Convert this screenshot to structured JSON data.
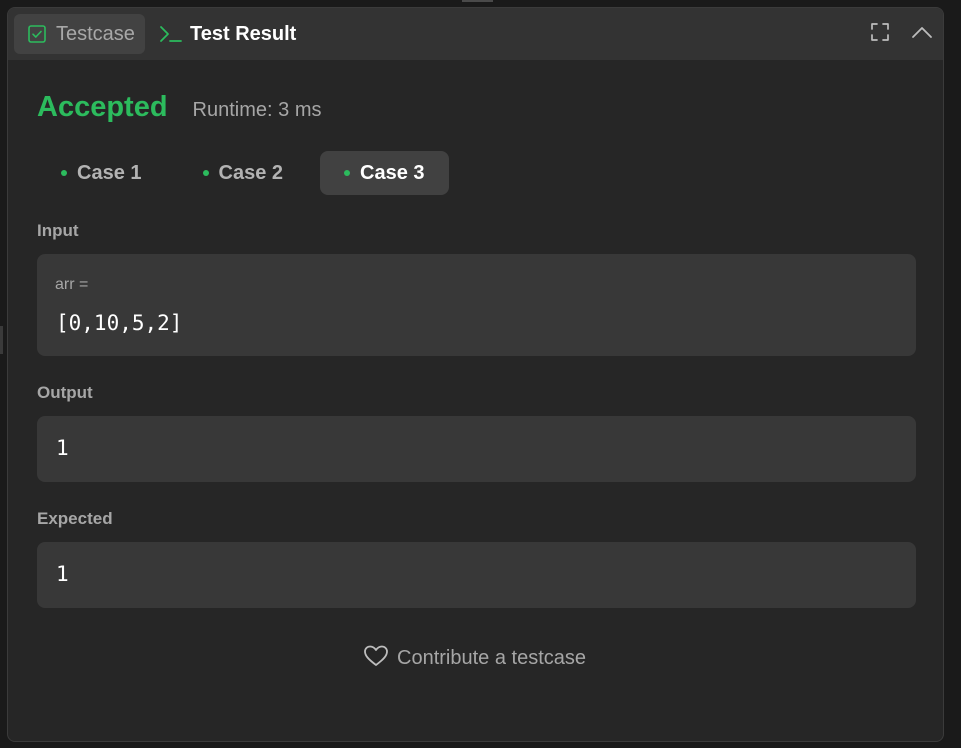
{
  "tabs": {
    "testcase_label": "Testcase",
    "result_label": "Test Result"
  },
  "result": {
    "status": "Accepted",
    "runtime": "Runtime: 3 ms"
  },
  "cases": [
    {
      "label": "Case 1"
    },
    {
      "label": "Case 2"
    },
    {
      "label": "Case 3"
    }
  ],
  "active_case": "Case 3",
  "input": {
    "section_label": "Input",
    "var_name": "arr =",
    "value": "[0,10,5,2]"
  },
  "output": {
    "section_label": "Output",
    "value": "1"
  },
  "expected": {
    "section_label": "Expected",
    "value": "1"
  },
  "contribute_label": "Contribute a testcase",
  "colors": {
    "accent_green": "#2cbb5d",
    "panel_bg": "#262626",
    "box_bg": "#383838"
  },
  "icons": {
    "testcase": "checkbox-icon",
    "result": "terminal-icon",
    "expand": "fullscreen-icon",
    "collapse": "chevron-up-icon",
    "contribute": "heart-icon"
  }
}
